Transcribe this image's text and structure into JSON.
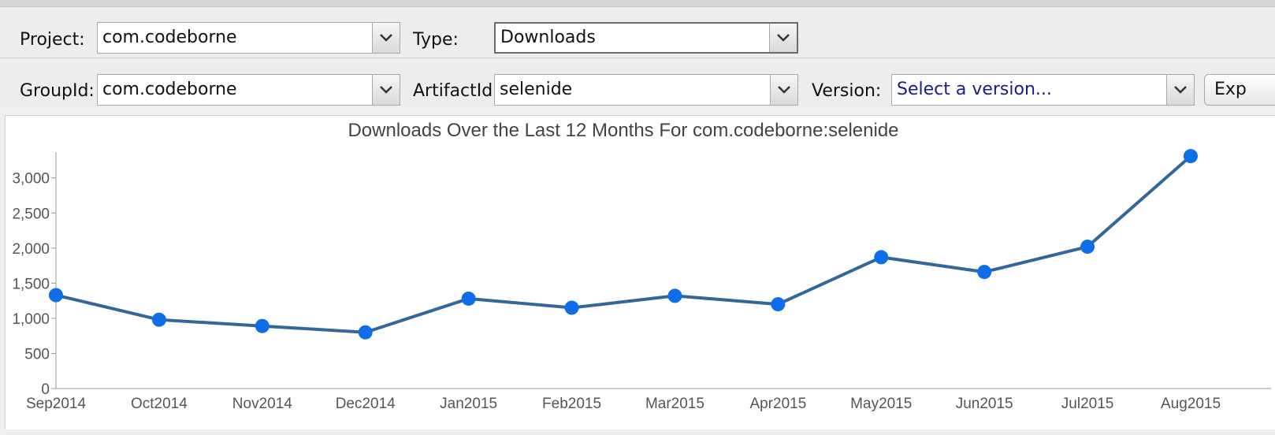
{
  "filters": {
    "project": {
      "label": "Project:",
      "value": "com.codeborne"
    },
    "type": {
      "label": "Type:",
      "value": "Downloads"
    },
    "group_id": {
      "label": "GroupId:",
      "value": "com.codeborne"
    },
    "artifact_id": {
      "label": "ArtifactId:",
      "value": "selenide"
    },
    "version": {
      "label": "Version:",
      "value": "Select a version..."
    },
    "export_button": {
      "label": "Exp"
    }
  },
  "icons": {
    "dropdown": "chevron-down-icon"
  },
  "colors": {
    "line": "#336699",
    "marker": "#0d6ee8",
    "axis": "#999999",
    "text": "#555555"
  },
  "chart_data": {
    "type": "line",
    "title": "Downloads Over the Last 12 Months For com.codeborne:selenide",
    "categories": [
      "Sep2014",
      "Oct2014",
      "Nov2014",
      "Dec2014",
      "Jan2015",
      "Feb2015",
      "Mar2015",
      "Apr2015",
      "May2015",
      "Jun2015",
      "Jul2015",
      "Aug2015"
    ],
    "series": [
      {
        "values": [
          1330,
          980,
          890,
          800,
          1280,
          1150,
          1320,
          1200,
          1870,
          1660,
          2020,
          3310
        ]
      }
    ],
    "ylim": [
      0,
      3300
    ],
    "yticks": [
      0,
      500,
      1000,
      1500,
      2000,
      2500,
      3000
    ],
    "ytick_labels": [
      "0",
      "500",
      "1,000",
      "1,500",
      "2,000",
      "2,500",
      "3,000"
    ],
    "grid": false,
    "legend": "none"
  }
}
